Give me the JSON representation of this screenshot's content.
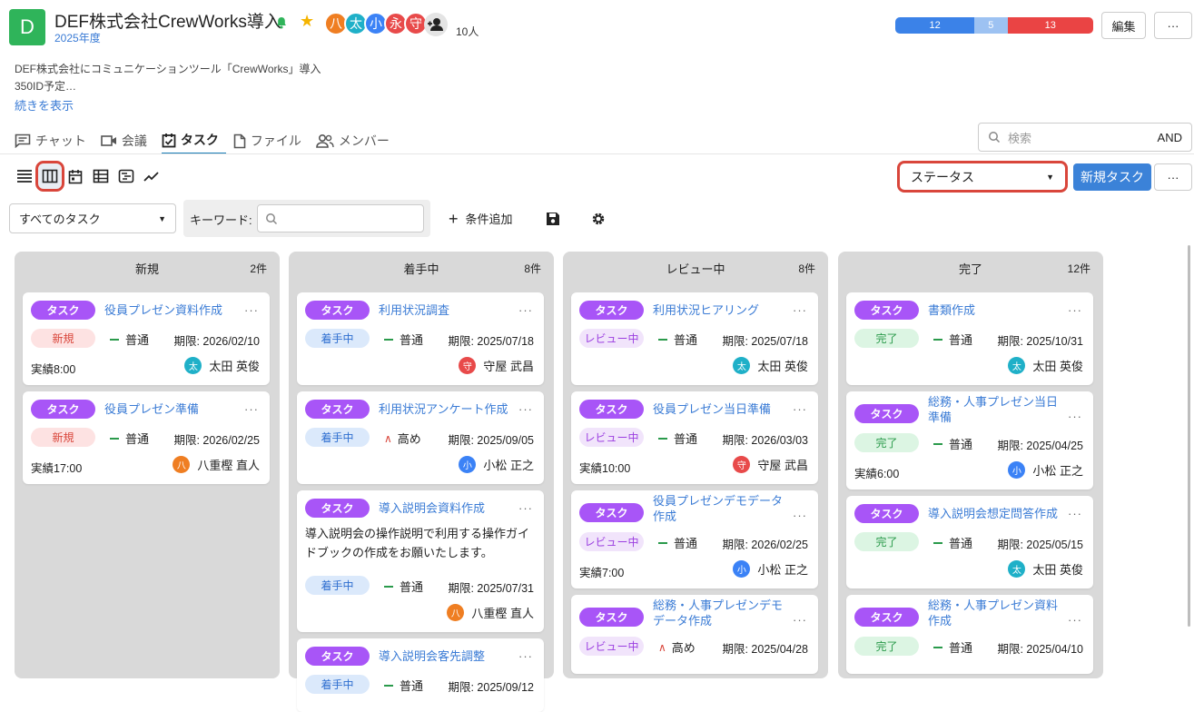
{
  "project": {
    "logo_letter": "D",
    "title": "DEF株式会社CrewWorks導入",
    "year": "2025年度",
    "member_count": "10人",
    "description_line1": "DEF株式会社にコミュニケーションツール「CrewWorks」導入",
    "description_line2": "350ID予定…",
    "show_more": "続きを表示"
  },
  "members": [
    {
      "initial": "八",
      "color": "#ef7e22"
    },
    {
      "initial": "太",
      "color": "#1fb0c8"
    },
    {
      "initial": "小",
      "color": "#3b82f6"
    },
    {
      "initial": "永",
      "color": "#e84a4a"
    },
    {
      "initial": "守",
      "color": "#e84a4a"
    }
  ],
  "status_bar": {
    "values": [
      12,
      5,
      13
    ],
    "colors": [
      "#3b82e8",
      "#9dc2f2",
      "#ea4444"
    ]
  },
  "header_buttons": {
    "edit": "編集",
    "more": "···"
  },
  "tabs": [
    {
      "label": "チャット",
      "icon": "chat-icon"
    },
    {
      "label": "会議",
      "icon": "video-icon"
    },
    {
      "label": "タスク",
      "icon": "task-icon",
      "active": true
    },
    {
      "label": "ファイル",
      "icon": "file-icon"
    },
    {
      "label": "メンバー",
      "icon": "members-icon"
    }
  ],
  "search": {
    "placeholder": "検索",
    "mode": "AND"
  },
  "view_icons": [
    "list-view-icon",
    "board-view-icon",
    "calendar-view-icon",
    "table-view-icon",
    "gantt-view-icon",
    "chart-view-icon"
  ],
  "group_by": "ステータス",
  "new_task": "新規タスク",
  "filter": {
    "selected": "すべてのタスク",
    "keyword_label": "キーワード:",
    "add_condition": "条件追加"
  },
  "columns": [
    {
      "title": "新規",
      "count": "2件",
      "cards": [
        {
          "type": "タスク",
          "title": "役員プレゼン資料作成",
          "status": "新規",
          "priority": "普通",
          "due": "期限: 2026/02/10",
          "actual": "実績8:00",
          "assignee": "太田 英俊",
          "av": "太",
          "avc": "#1fb0c8"
        },
        {
          "type": "タスク",
          "title": "役員プレゼン準備",
          "status": "新規",
          "priority": "普通",
          "due": "期限: 2026/02/25",
          "actual": "実績17:00",
          "assignee": "八重樫 直人",
          "av": "八",
          "avc": "#ef7e22"
        }
      ]
    },
    {
      "title": "着手中",
      "count": "8件",
      "cards": [
        {
          "type": "タスク",
          "title": "利用状況調査",
          "status": "着手中",
          "priority": "普通",
          "due": "期限: 2025/07/18",
          "actual": "",
          "assignee": "守屋 武昌",
          "av": "守",
          "avc": "#e84a4a"
        },
        {
          "type": "タスク",
          "title": "利用状況アンケート作成",
          "status": "着手中",
          "priority": "高め",
          "due": "期限: 2025/09/05",
          "actual": "",
          "assignee": "小松 正之",
          "av": "小",
          "avc": "#3b82f6"
        },
        {
          "type": "タスク",
          "title": "導入説明会資料作成",
          "desc": "導入説明会の操作説明で利用する操作ガイドブックの作成をお願いたします。",
          "status": "着手中",
          "priority": "普通",
          "due": "期限: 2025/07/31",
          "actual": "",
          "assignee": "八重樫 直人",
          "av": "八",
          "avc": "#ef7e22"
        },
        {
          "type": "タスク",
          "title": "導入説明会客先調整",
          "status": "着手中",
          "priority": "普通",
          "due": "期限: 2025/09/12",
          "actual": "",
          "assignee": "",
          "av": "",
          "avc": ""
        }
      ]
    },
    {
      "title": "レビュー中",
      "count": "8件",
      "cards": [
        {
          "type": "タスク",
          "title": "利用状況ヒアリング",
          "status": "レビュー中",
          "priority": "普通",
          "due": "期限: 2025/07/18",
          "actual": "",
          "assignee": "太田 英俊",
          "av": "太",
          "avc": "#1fb0c8"
        },
        {
          "type": "タスク",
          "title": "役員プレゼン当日準備",
          "status": "レビュー中",
          "priority": "普通",
          "due": "期限: 2026/03/03",
          "actual": "実績10:00",
          "assignee": "守屋 武昌",
          "av": "守",
          "avc": "#e84a4a"
        },
        {
          "type": "タスク",
          "title": "役員プレゼンデモデータ作成",
          "status": "レビュー中",
          "priority": "普通",
          "due": "期限: 2026/02/25",
          "actual": "実績7:00",
          "assignee": "小松 正之",
          "av": "小",
          "avc": "#3b82f6"
        },
        {
          "type": "タスク",
          "title": "総務・人事プレゼンデモデータ作成",
          "status": "レビュー中",
          "priority": "高め",
          "due": "期限: 2025/04/28",
          "actual": "",
          "assignee": "",
          "av": "",
          "avc": ""
        }
      ]
    },
    {
      "title": "完了",
      "count": "12件",
      "cards": [
        {
          "type": "タスク",
          "title": "書類作成",
          "status": "完了",
          "priority": "普通",
          "due": "期限: 2025/10/31",
          "actual": "",
          "assignee": "太田 英俊",
          "av": "太",
          "avc": "#1fb0c8"
        },
        {
          "type": "タスク",
          "title": "総務・人事プレゼン当日準備",
          "status": "完了",
          "priority": "普通",
          "due": "期限: 2025/04/25",
          "actual": "実績6:00",
          "assignee": "小松 正之",
          "av": "小",
          "avc": "#3b82f6"
        },
        {
          "type": "タスク",
          "title": "導入説明会想定問答作成",
          "status": "完了",
          "priority": "普通",
          "due": "期限: 2025/05/15",
          "actual": "",
          "assignee": "太田 英俊",
          "av": "太",
          "avc": "#1fb0c8"
        },
        {
          "type": "タスク",
          "title": "総務・人事プレゼン資料作成",
          "status": "完了",
          "priority": "普通",
          "due": "期限: 2025/04/10",
          "actual": "",
          "assignee": "",
          "av": "",
          "avc": ""
        }
      ]
    }
  ],
  "status_styles": {
    "新規": {
      "bg": "#fde2e2",
      "fg": "#d9463b"
    },
    "着手中": {
      "bg": "#dbe9fb",
      "fg": "#2f6fd0"
    },
    "レビュー中": {
      "bg": "#f1e4fb",
      "fg": "#9b3fe0"
    },
    "完了": {
      "bg": "#dcf5e3",
      "fg": "#2a9a4b"
    }
  }
}
